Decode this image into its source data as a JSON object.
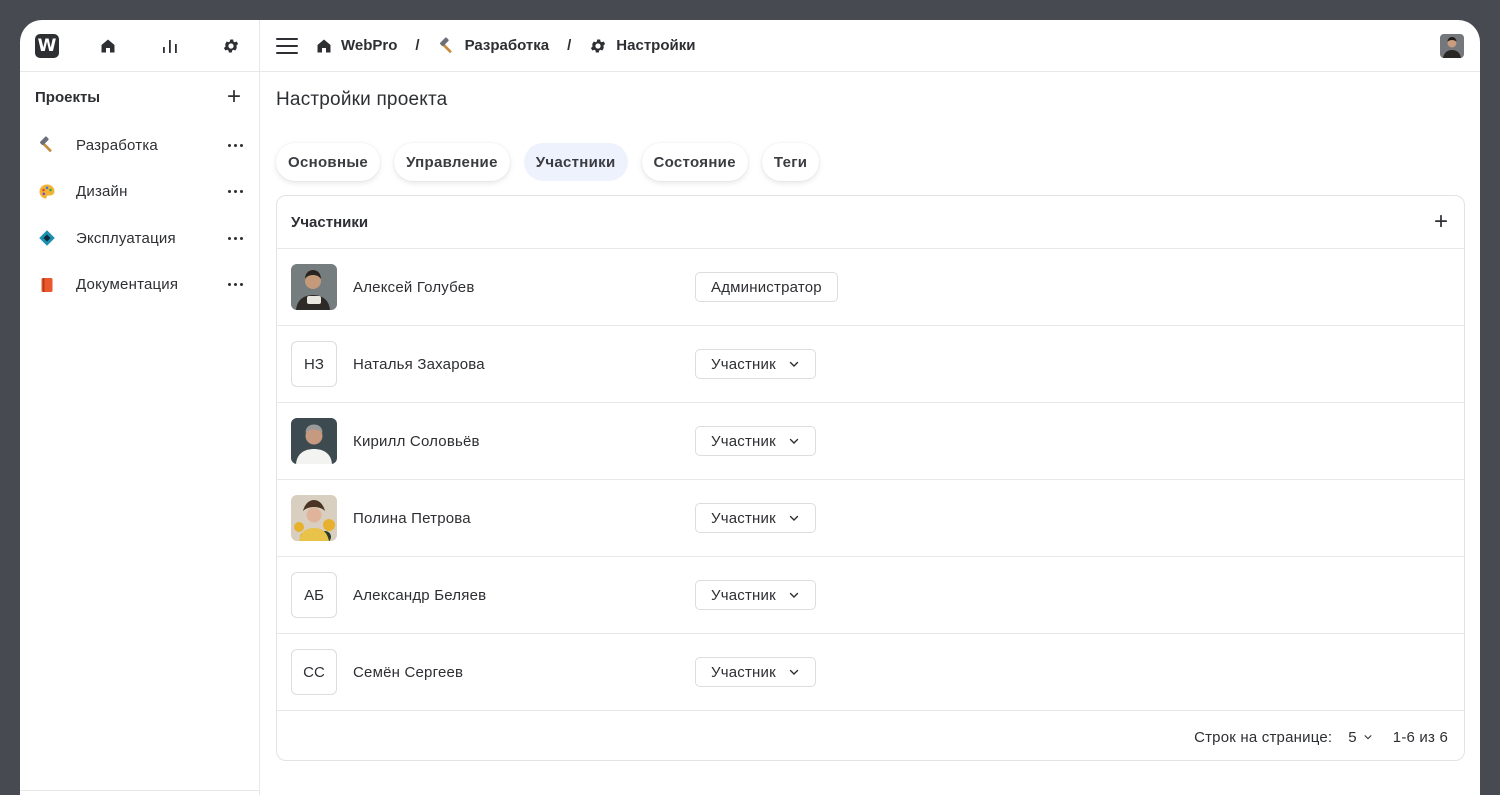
{
  "app": {
    "logo_letter": "W"
  },
  "sidebar": {
    "projects_title": "Проекты",
    "add_symbol": "+",
    "items": [
      {
        "label": "Разработка",
        "icon": "hammer-icon"
      },
      {
        "label": "Дизайн",
        "icon": "palette-icon"
      },
      {
        "label": "Эксплуатация",
        "icon": "diamond-icon"
      },
      {
        "label": "Документация",
        "icon": "book-icon"
      }
    ]
  },
  "breadcrumbs": [
    {
      "label": "WebPro",
      "icon": "home-icon"
    },
    {
      "label": "Разработка",
      "icon": "hammer-icon"
    },
    {
      "label": "Настройки",
      "icon": "gear-icon"
    }
  ],
  "breadcrumb_separator": "/",
  "page": {
    "title": "Настройки проекта"
  },
  "tabs": [
    {
      "label": "Основные",
      "active": false
    },
    {
      "label": "Управление",
      "active": false
    },
    {
      "label": "Участники",
      "active": true
    },
    {
      "label": "Состояние",
      "active": false
    },
    {
      "label": "Теги",
      "active": false
    }
  ],
  "members_card": {
    "title": "Участники",
    "add_symbol": "+",
    "members": [
      {
        "name": "Алексей Голубев",
        "avatar": "photo",
        "initials": "",
        "role": "Администратор",
        "dropdown": false
      },
      {
        "name": "Наталья Захарова",
        "avatar": "initials",
        "initials": "НЗ",
        "role": "Участник",
        "dropdown": true
      },
      {
        "name": "Кирилл Соловьёв",
        "avatar": "photo",
        "initials": "",
        "role": "Участник",
        "dropdown": true
      },
      {
        "name": "Полина Петрова",
        "avatar": "photo",
        "initials": "",
        "role": "Участник",
        "dropdown": true
      },
      {
        "name": "Александр Беляев",
        "avatar": "initials",
        "initials": "АБ",
        "role": "Участник",
        "dropdown": true
      },
      {
        "name": "Семён Сергеев",
        "avatar": "initials",
        "initials": "СС",
        "role": "Участник",
        "dropdown": true
      }
    ]
  },
  "pagination": {
    "rows_label": "Строк на странице:",
    "rows_value": "5",
    "range": "1-6 из 6"
  },
  "colors": {
    "frame": "#474a51",
    "text": "#2d2f33",
    "active_tab": "#eef2fd",
    "border": "#e7e8ea"
  }
}
